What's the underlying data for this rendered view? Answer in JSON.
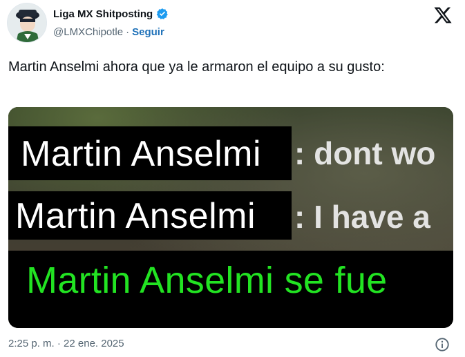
{
  "author": {
    "display_name": "Liga MX Shitposting",
    "handle": "@LMXChipotle",
    "separator": "·",
    "follow_label": "Seguir"
  },
  "tweet": {
    "text": "Martin Anselmi ahora que ya le armaron el equipo a su gusto:",
    "timestamp": "2:25 p. m. · 22 ene. 2025"
  },
  "media": {
    "line1": "Martin Anselmi",
    "line1_suffix": ": dont wo",
    "line2": "Martin Anselmi",
    "line2_suffix": ": I have a",
    "line3": "Martin Anselmi se fue"
  },
  "colors": {
    "verified": "#1d9bf0",
    "follow": "#1d70b8",
    "meme_green": "#22e322"
  },
  "icons": {
    "verified": "verified-badge-icon",
    "x_logo": "x-logo-icon",
    "info": "info-icon"
  }
}
